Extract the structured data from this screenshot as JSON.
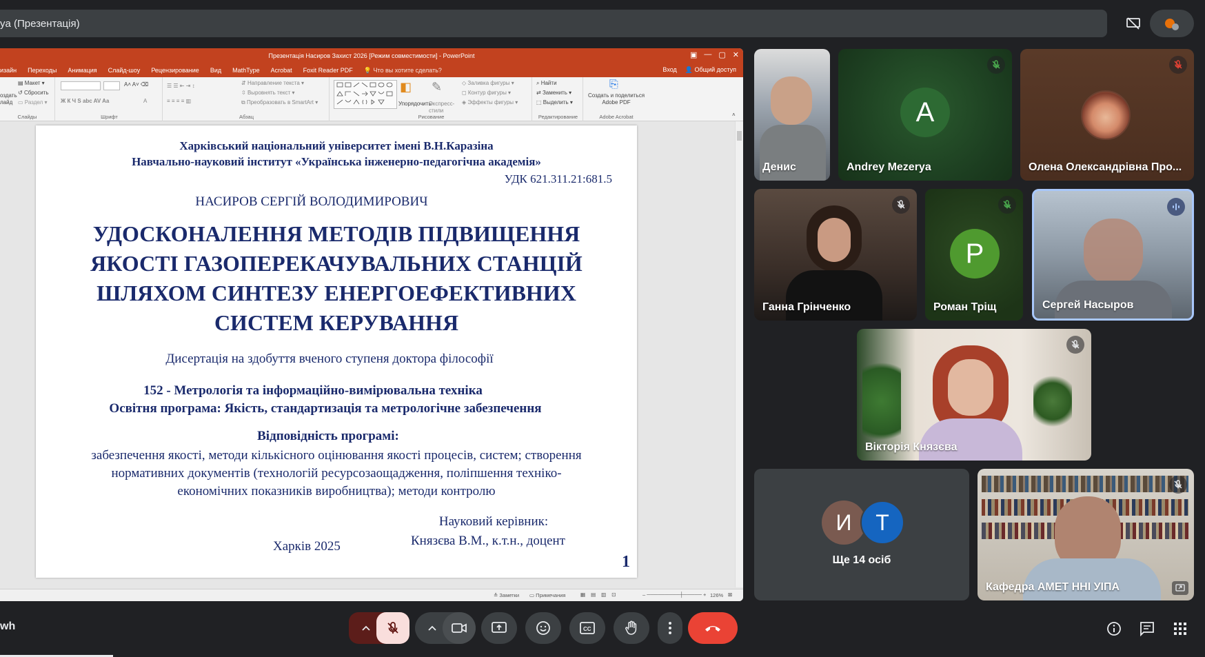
{
  "meeting": {
    "presentation_title": "ya (Презентація)",
    "user_label": "wh"
  },
  "ppt": {
    "window_title": "Презентація Насиров Захист 2026 [Режим совместимости] - PowerPoint",
    "tabs": [
      "изайн",
      "Переходы",
      "Анимация",
      "Слайд-шоу",
      "Рецензирование",
      "Вид",
      "MathType",
      "Acrobat",
      "Foxit Reader PDF"
    ],
    "tell_me": "Что вы хотите сделать?",
    "signin": "Вход",
    "share": "Общий доступ",
    "ribbon": {
      "slides_items": [
        "Макет",
        "Сбросить",
        "Раздел"
      ],
      "create_label": "оздать\nлайд",
      "slides_caption": "Слайды",
      "font_caption": "Шрифт",
      "paragraph_items": [
        "Направление текста",
        "Выровнять текст",
        "Преобразовать в SmartArt"
      ],
      "paragraph_caption": "Абзац",
      "arrange_label": "Упорядочить",
      "styles_label": "Экспресс-\nстили",
      "drawing_items": [
        "Заливка фигуры",
        "Контур фигуры",
        "Эффекты фигуры"
      ],
      "drawing_caption": "Рисование",
      "editing_items": [
        "Найти",
        "Заменить",
        "Выделить"
      ],
      "editing_caption": "Редактирование",
      "acrobat_label": "Создать и поделиться\nAdobe PDF",
      "acrobat_caption": "Adobe Acrobat"
    },
    "status": {
      "notes": "Заметки",
      "comments": "Примечания",
      "zoom": "126%"
    }
  },
  "slide": {
    "university": "Харківський національний університет імені В.Н.Каразіна",
    "institute": "Навчально-науковий інститут «Українська інженерно-педагогічна академія»",
    "udk": "УДК 621.311.21:681.5",
    "author": "НАСИРОВ СЕРГІЙ ВОЛОДИМИРОВИЧ",
    "title_lines": [
      "УДОСКОНАЛЕННЯ МЕТОДІВ ПІДВИЩЕННЯ",
      "ЯКОСТІ ГАЗОПЕРЕКАЧУВАЛЬНИХ СТАНЦІЙ",
      "ШЛЯХОМ СИНТЕЗУ ЕНЕРГОЕФЕКТИВНИХ",
      "СИСТЕМ КЕРУВАННЯ"
    ],
    "degree": "Дисертація на здобуття вченого ступеня доктора філософії",
    "specialty": "152 - Метрологія та інформаційно-вимірювальна техніка",
    "program": "Освітня  програма: Якість, стандартизація та метрологічне забезпечення",
    "compliance_heading": "Відповідність програмі:",
    "compliance_lines": [
      "забезпечення якості, методи кількісного оцінювання якості процесів, систем; створення",
      "нормативних документів (технологій ресурсозаощадження, поліпшення техніко-",
      "економічних показників виробництва); методи контролю"
    ],
    "supervisor_label": "Науковий керівник:",
    "supervisor_name": "Князєва В.М., к.т.н., доцент",
    "city_year": "Харків 2025",
    "page_number": "1"
  },
  "participants": [
    {
      "name": "Денис",
      "type": "video",
      "muted": false
    },
    {
      "name": "Andrey Mezerya",
      "initial": "A",
      "type": "avatar",
      "color": "#1e5e2a",
      "muted": true
    },
    {
      "name": "Олена Олександрівна Про...",
      "type": "photo",
      "muted": true
    },
    {
      "name": "Ганна Грінченко",
      "type": "video",
      "muted": true
    },
    {
      "name": "Роман Тріщ",
      "initial": "P",
      "type": "avatar",
      "color": "#4a8b2a",
      "muted": true
    },
    {
      "name": "Сергей Насыров",
      "type": "video",
      "speaking": true
    },
    {
      "name": "Вікторія Князєва",
      "type": "video",
      "muted": true
    },
    {
      "name": "Кафедра АМЕТ ННІ УІПА",
      "type": "video",
      "muted": true
    }
  ],
  "others": {
    "label": "Ще 14 осіб",
    "initials": [
      "И",
      "Т"
    ],
    "colors": [
      "#7a5a50",
      "#1565c0"
    ]
  },
  "colors": {
    "end_call": "#ea4335",
    "mic_off_bg": "#f9dedc",
    "speaking_border": "#a8c7fa"
  }
}
